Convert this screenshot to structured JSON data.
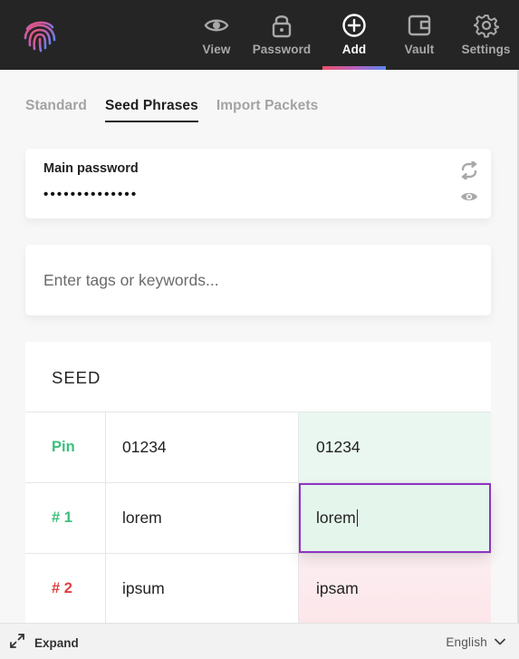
{
  "header": {
    "nav": [
      {
        "label": "View",
        "icon": "eye-icon"
      },
      {
        "label": "Password",
        "icon": "lock-icon"
      },
      {
        "label": "Add",
        "icon": "plus-circle-icon",
        "active": true
      },
      {
        "label": "Vault",
        "icon": "wallet-icon"
      },
      {
        "label": "Settings",
        "icon": "gear-icon"
      }
    ],
    "colors": {
      "background": "#252525",
      "active_gradient": [
        "#ef4f6a",
        "#b463c4",
        "#5a86ee"
      ]
    }
  },
  "tabs": [
    {
      "label": "Standard"
    },
    {
      "label": "Seed Phrases",
      "active": true
    },
    {
      "label": "Import Packets"
    }
  ],
  "password": {
    "label": "Main password",
    "value": "••••••••••••••"
  },
  "tags": {
    "placeholder": "Enter tags or keywords..."
  },
  "seed": {
    "title": "SEED",
    "rows": [
      {
        "index": "Pin",
        "original": "01234",
        "confirm": "01234",
        "status": "match"
      },
      {
        "index": "# 1",
        "original": "lorem",
        "confirm": "lorem",
        "status": "match"
      },
      {
        "index": "# 2",
        "original": "ipsum",
        "confirm": "ipsam",
        "status": "mismatch"
      }
    ],
    "colors": {
      "match": "#3cbf7d",
      "mismatch": "#e04040",
      "focus_outline": "#8e34c0"
    }
  },
  "footer": {
    "expand_label": "Expand",
    "language": "English"
  }
}
